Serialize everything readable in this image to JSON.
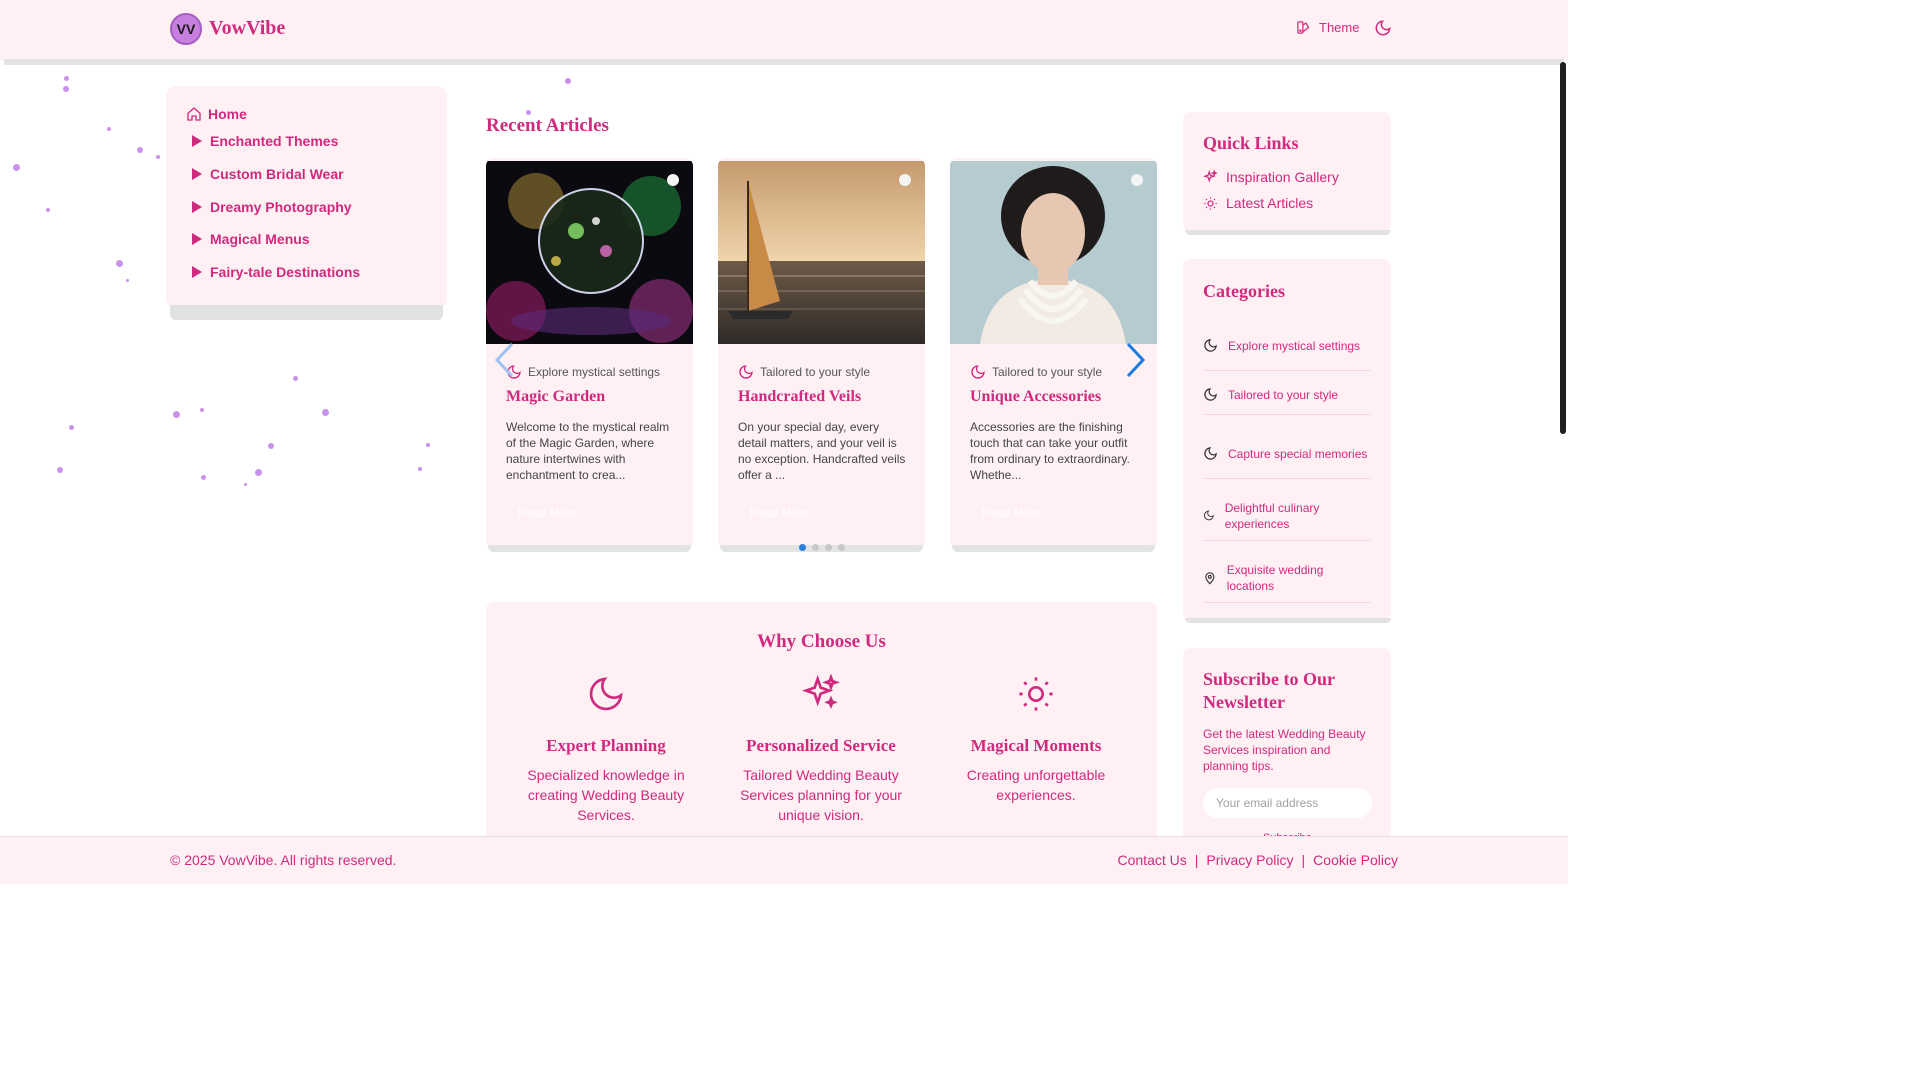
{
  "brand": {
    "initials": "VV",
    "name": "VowVibe"
  },
  "header": {
    "theme_label": "Theme",
    "icons": [
      "palette-icon",
      "moon-icon"
    ]
  },
  "sidebar": {
    "home": "Home",
    "items": [
      {
        "label": "Enchanted Themes"
      },
      {
        "label": "Custom Bridal Wear"
      },
      {
        "label": "Dreamy Photography"
      },
      {
        "label": "Magical Menus"
      },
      {
        "label": "Fairy-tale Destinations"
      }
    ]
  },
  "articles": {
    "title": "Recent Articles",
    "read_more": "Read More",
    "cards": [
      {
        "tag": "Explore mystical settings",
        "title": "Magic Garden",
        "excerpt": "Welcome to the mystical realm of the Magic Garden, where nature intertwines with enchantment to crea...",
        "image": "crystal-ball-lights"
      },
      {
        "tag": "Tailored to your style",
        "title": "Handcrafted Veils",
        "excerpt": "On your special day, every detail matters, and your veil is no exception. Handcrafted veils offer a ...",
        "image": "sailboat-sunset"
      },
      {
        "tag": "Tailored to your style",
        "title": "Unique Accessories",
        "excerpt": "Accessories are the finishing touch that can take your outfit from ordinary to extraordinary. Whethe...",
        "image": "pearl-necklace-portrait"
      }
    ],
    "pager": {
      "count": 4,
      "active": 0
    }
  },
  "why": {
    "title": "Why Choose Us",
    "features": [
      {
        "title": "Expert Planning",
        "desc": "Specialized knowledge in creating Wedding Beauty Services.",
        "icon": "moon-icon"
      },
      {
        "title": "Personalized Service",
        "desc": "Tailored Wedding Beauty Services planning for your unique vision.",
        "icon": "sparkles-icon"
      },
      {
        "title": "Magical Moments",
        "desc": "Creating unforgettable experiences.",
        "icon": "sun-icon"
      }
    ]
  },
  "quick_links": {
    "title": "Quick Links",
    "items": [
      {
        "label": "Inspiration Gallery",
        "icon": "sparkles-icon"
      },
      {
        "label": "Latest Articles",
        "icon": "sun-icon"
      }
    ]
  },
  "categories": {
    "title": "Categories",
    "items": [
      {
        "label": "Explore mystical settings",
        "icon": "moon-icon"
      },
      {
        "label": "Tailored to your style",
        "icon": "moon-icon"
      },
      {
        "label": "Capture special memories",
        "icon": "moon-icon"
      },
      {
        "label": "Delightful culinary experiences",
        "icon": "moon-icon"
      },
      {
        "label": "Exquisite wedding locations",
        "icon": "map-pin-icon"
      }
    ]
  },
  "newsletter": {
    "title": "Subscribe to Our Newsletter",
    "desc": "Get the latest Wedding Beauty Services inspiration and planning tips.",
    "placeholder": "Your email address",
    "button": "Subscribe"
  },
  "footer": {
    "copyright": "© 2025 VowVibe. All rights reserved.",
    "links": [
      "Contact Us",
      "Privacy Policy",
      "Cookie Policy"
    ],
    "separator": "|"
  },
  "colors": {
    "accent": "#d02a7f",
    "panel": "#fff0f4",
    "particle": "#c07ee8"
  }
}
